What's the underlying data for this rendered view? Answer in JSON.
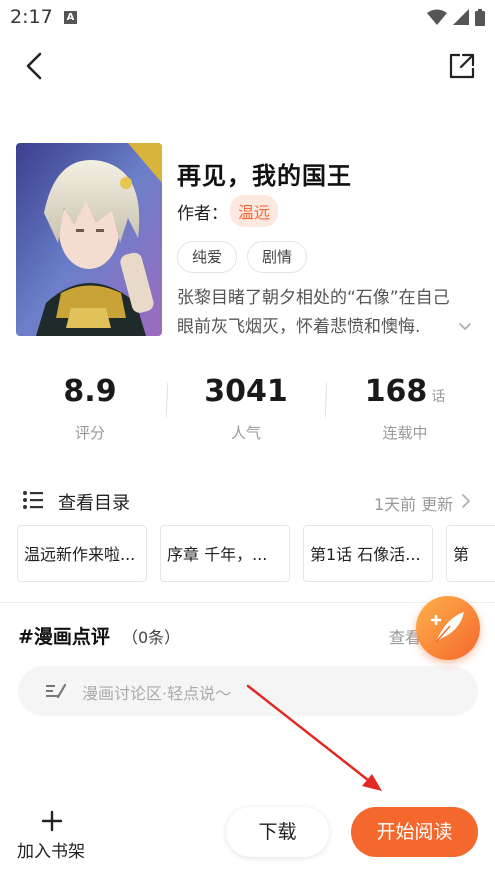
{
  "status_bar": {
    "time": "2:17",
    "notification_badge": "A"
  },
  "book": {
    "title": "再见，我的国王",
    "author_label": "作者：",
    "author": "温远",
    "tags": [
      "纯爱",
      "剧情"
    ],
    "description_lines": [
      "张黎目睹了朝夕相处的“石像”在自己",
      "眼前灰飞烟灭，怀着悲愤和懊悔."
    ]
  },
  "stats": {
    "rating": {
      "value": "8.9",
      "label": "评分"
    },
    "popularity": {
      "value": "3041",
      "label": "人气"
    },
    "chapters": {
      "value": "168",
      "unit": "话",
      "label": "连载中"
    }
  },
  "catalog": {
    "title": "查看目录",
    "update": "1天前 更新",
    "chapters": [
      "温远新作来啦...",
      "序章  千年，...",
      "第1话  石像活...",
      "第"
    ]
  },
  "comments": {
    "title": "#漫画点评",
    "count": "（0条）",
    "view_all": "查看",
    "placeholder": "漫画讨论区·轻点说～"
  },
  "bottom_bar": {
    "shelf_label": "加入书架",
    "download_label": "下载",
    "read_label": "开始阅读"
  },
  "colors": {
    "accent": "#f4682e",
    "author_bg": "#fde8e0",
    "annotation_arrow": "#e02a23"
  }
}
